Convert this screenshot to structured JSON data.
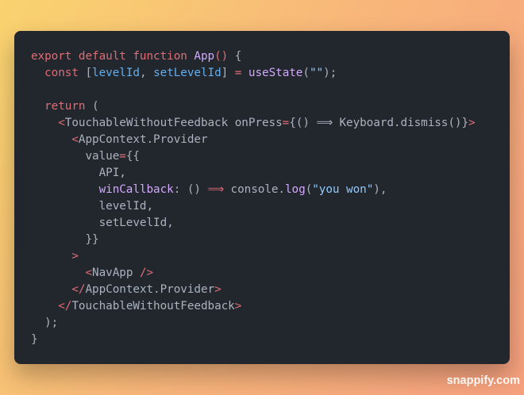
{
  "editor": {
    "lines": [
      [
        [
          "kw",
          "export default function "
        ],
        [
          "fn",
          "App"
        ],
        [
          "br",
          "()"
        ],
        [
          "pu",
          " {"
        ]
      ],
      [
        [
          "pl",
          "  "
        ],
        [
          "kw",
          "const "
        ],
        [
          "pu",
          "["
        ],
        [
          "var",
          "levelId"
        ],
        [
          "pu",
          ", "
        ],
        [
          "var",
          "setLevelId"
        ],
        [
          "pu",
          "] "
        ],
        [
          "op",
          "="
        ],
        [
          "pl",
          " "
        ],
        [
          "fn",
          "useState"
        ],
        [
          "pu",
          "("
        ],
        [
          "str",
          "\"\""
        ],
        [
          "pu",
          ");"
        ]
      ],
      [],
      [
        [
          "pl",
          "  "
        ],
        [
          "kw",
          "return"
        ],
        [
          "pu",
          " ("
        ]
      ],
      [
        [
          "pl",
          "    "
        ],
        [
          "br",
          "<"
        ],
        [
          "tag",
          "TouchableWithoutFeedback onPress"
        ],
        [
          "op",
          "="
        ],
        [
          "pu",
          "{() "
        ],
        [
          "pu",
          "⟹"
        ],
        [
          "pu",
          " Keyboard.dismiss()}"
        ],
        [
          "br",
          ">"
        ]
      ],
      [
        [
          "pl",
          "      "
        ],
        [
          "br",
          "<"
        ],
        [
          "tag",
          "AppContext.Provider"
        ]
      ],
      [
        [
          "pl",
          "        "
        ],
        [
          "tag",
          "value"
        ],
        [
          "op",
          "="
        ],
        [
          "pu",
          "{{"
        ]
      ],
      [
        [
          "pl",
          "          API,"
        ]
      ],
      [
        [
          "pl",
          "          "
        ],
        [
          "cl",
          "winCallback"
        ],
        [
          "pu",
          ": () "
        ],
        [
          "op",
          "⟹"
        ],
        [
          "pu",
          " console."
        ],
        [
          "fn",
          "log"
        ],
        [
          "pu",
          "("
        ],
        [
          "str",
          "\"you won\""
        ],
        [
          "pu",
          "),"
        ]
      ],
      [
        [
          "pl",
          "          levelId,"
        ]
      ],
      [
        [
          "pl",
          "          setLevelId,"
        ]
      ],
      [
        [
          "pl",
          "        }}"
        ]
      ],
      [
        [
          "pl",
          "      "
        ],
        [
          "br",
          ">"
        ]
      ],
      [
        [
          "pl",
          "        "
        ],
        [
          "br",
          "<"
        ],
        [
          "tag",
          "NavApp "
        ],
        [
          "br",
          "/>"
        ]
      ],
      [
        [
          "pl",
          "      "
        ],
        [
          "br",
          "</"
        ],
        [
          "tag",
          "AppContext.Provider"
        ],
        [
          "br",
          ">"
        ]
      ],
      [
        [
          "pl",
          "    "
        ],
        [
          "br",
          "</"
        ],
        [
          "tag",
          "TouchableWithoutFeedback"
        ],
        [
          "br",
          ">"
        ]
      ],
      [
        [
          "pl",
          "  );"
        ]
      ],
      [
        [
          "pl",
          "}"
        ]
      ]
    ]
  },
  "watermark": "snappify.com"
}
